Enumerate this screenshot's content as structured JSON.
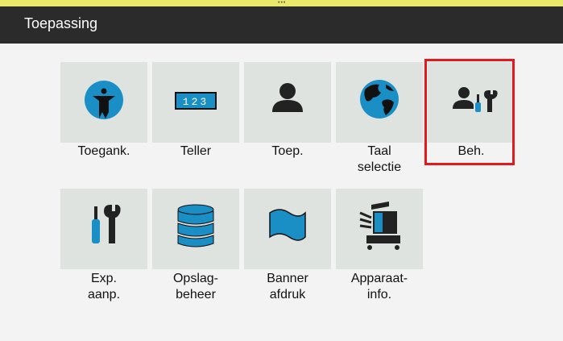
{
  "header": {
    "title": "Toepassing"
  },
  "tiles": [
    {
      "label": "Toegank.",
      "icon": "accessibility-icon"
    },
    {
      "label": "Teller",
      "icon": "counter-icon",
      "counter_text": "123"
    },
    {
      "label": "Toep.",
      "icon": "user-icon"
    },
    {
      "label": "Taal\nselectie",
      "icon": "globe-icon"
    },
    {
      "label": "Beh.",
      "icon": "admin-tools-icon"
    },
    {
      "label": "Exp.\naanp.",
      "icon": "wrench-screwdriver-icon"
    },
    {
      "label": "Opslag-\nbeheer",
      "icon": "database-icon"
    },
    {
      "label": "Banner\nafdruk",
      "icon": "banner-icon"
    },
    {
      "label": "Apparaat-\ninfo.",
      "icon": "printer-icon"
    }
  ],
  "colors": {
    "accent_blue": "#1a8fc6",
    "highlight_red": "#e3191c",
    "header_bg": "#2b2b2b",
    "tile_bg": "#dfe3e0"
  }
}
